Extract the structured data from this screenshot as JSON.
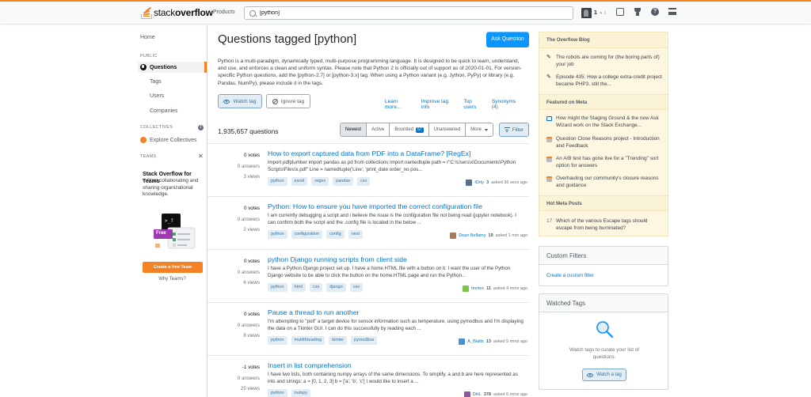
{
  "header": {
    "logo_text_light": "stack",
    "logo_text_bold": "overflow",
    "products_label": "Products",
    "search_value": "[python]",
    "reputation": "1",
    "badge_count": "● 1",
    "help_glyph": "?"
  },
  "leftnav": {
    "home": "Home",
    "public_label": "PUBLIC",
    "questions": "Questions",
    "tags": "Tags",
    "users": "Users",
    "companies": "Companies",
    "collectives_label": "COLLECTIVES",
    "explore_collectives": "Explore Collectives",
    "teams_label": "TEAMS",
    "teams_title": "Stack Overflow for Teams",
    "teams_desc": "– Start collaborating and sharing organizational knowledge.",
    "free_badge": "Free",
    "create_team": "Create a free Team",
    "why_teams": "Why Teams?"
  },
  "main": {
    "title": "Questions tagged [python]",
    "ask_button": "Ask Question",
    "description": "Python is a multi-paradigm, dynamically typed, multi-purpose programming language. It is designed to be quick to learn, understand, and use, and enforces a clean and uniform syntax. Please note that Python 2 is officially out of support as of 2020-01-01. For version-specific Python questions, add the [python-2.7] or [python-3.x] tag. When using a Python variant (e.g. Jython, PyPy) or library (e.g. Pandas, NumPy), please include it in the tags.",
    "watch_tag": "Watch tag",
    "ignore_tag": "Ignore tag",
    "tag_links": [
      "Learn more...",
      "Improve tag info",
      "Top users",
      "Synonyms (4)"
    ],
    "question_count": "1,935,657 questions",
    "tabs": {
      "newest": "Newest",
      "active": "Active",
      "bountied": "Bountied",
      "bounty_count": "57",
      "unanswered": "Unanswered",
      "more": "More"
    },
    "filter": "Filter"
  },
  "questions": [
    {
      "votes": "0 votes",
      "answers": "0 answers",
      "views": "3 views",
      "title": "How to export captured data from PDF into a DataFrame? [RegEx]",
      "excerpt": "import pdfplumber import pandas as pd from collections import namedtuple path = r\"C:\\Users\\x\\Documents\\Python Scripts\\Files\\x.pdf\" Line = namedtuple('Line', 'print_date order_no pos...",
      "tags": [
        "python",
        "excel",
        "regex",
        "pandas",
        "csv"
      ],
      "user": "lOrty",
      "rep": "3",
      "time": "asked 36 secs ago",
      "avatar_color": "#5a6e8c"
    },
    {
      "votes": "0 votes",
      "answers": "0 answers",
      "views": "2 views",
      "title": "Python: How to ensure you have imported the correct configuration file",
      "excerpt": "I am currently debugging a script and i believe the issue is the configuration file not being read (jupyter notebook). I can confirm both the script and the .config file is located in the below ...",
      "tags": [
        "python",
        "configuration",
        "config",
        "next"
      ],
      "user": "Dean Bellamy",
      "rep": "19",
      "time": "asked 1 min ago",
      "avatar_color": "#a67b5b"
    },
    {
      "votes": "0 votes",
      "answers": "0 answers",
      "views": "6 views",
      "title": "python Django running scripts from client side",
      "excerpt": "I have a Python Django project set up. I have a home.HTML file with a button on it. I want the user of the Python Django website to be able to click the button on the home.HTML page and run the Python...",
      "tags": [
        "python",
        "html",
        "css",
        "django",
        "csv"
      ],
      "user": "tinnies",
      "rep": "11",
      "time": "asked 4 mins ago",
      "avatar_color": "#7cc44a"
    },
    {
      "votes": "0 votes",
      "answers": "0 answers",
      "views": "8 views",
      "title": "Pause a thread to run another",
      "excerpt": "I'm attempting to \"poll\" a target device for sensor information such as temperature, using pymodbus and I'm displaying the data on a Tkinter GUI. I can do this successfully by reading each ...",
      "tags": [
        "python",
        "multithreading",
        "tkinter",
        "pymodbus"
      ],
      "user": "A_Watts",
      "rep": "13",
      "time": "asked 5 mins ago",
      "avatar_color": "#4a8fd4"
    },
    {
      "votes": "-1 votes",
      "answers": "0 answers",
      "views": "25 views",
      "title": "Insert in list comprehension",
      "excerpt": "I have two lists, both containing numpy arrays of the same dimensions. To simplify, a and b are here represented as ints and strings: a = [0, 1, 2, 3] b = ['a', 'b', 'c'] I would like to insert a ...",
      "tags": [
        "python",
        "numpy"
      ],
      "user": "DHL",
      "rep": "378",
      "time": "asked 6 mins ago",
      "avatar_color": "#8a5a9c"
    }
  ],
  "sidebar": {
    "blog_title": "The Overflow Blog",
    "blog_items": [
      "The robots are coming for (the boring parts of) your job",
      "Episode 435: How a college extra-credit project became PHP3, still the..."
    ],
    "meta_title": "Featured on Meta",
    "meta_items": [
      "How might the Staging Ground & the new Ask Wizard work on the Stack Exchange...",
      "Question Close Reasons project - Introduction and Feedback",
      "An A/B test has gone live for a \"Trending\" sort option for answers",
      "Overhauling our community's closure reasons and guidance"
    ],
    "hot_title": "Hot Meta Posts",
    "hot_items": [
      {
        "count": "17",
        "text": "Which of the various Escape tags should escape from being burninated?"
      }
    ],
    "custom_filters_title": "Custom Filters",
    "create_filter": "Create a custom filter",
    "watched_title": "Watched Tags",
    "watched_text": "Watch tags to curate your list of questions.",
    "watch_a_tag": "Watch a tag"
  }
}
